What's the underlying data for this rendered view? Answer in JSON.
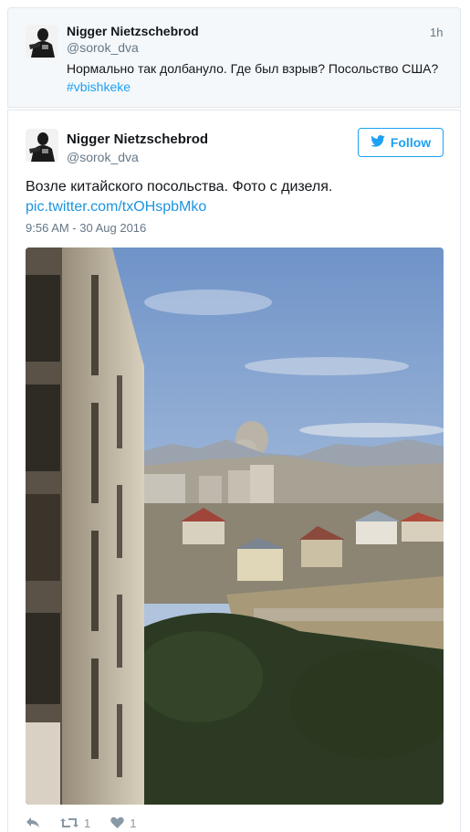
{
  "parent_tweet": {
    "name": "Nigger Nietzschebrod",
    "handle": "@sorok_dva",
    "time": "1h",
    "text": "Нормально так долбануло. Где был взрыв? Посольство США?",
    "hashtag": "#vbishkeke"
  },
  "main_tweet": {
    "name": "Nigger Nietzschebrod",
    "handle": "@sorok_dva",
    "follow_label": "Follow",
    "text": "Возле китайского посольства. Фото с дизеля.",
    "link": "pic.twitter.com/txOHspbMko",
    "timestamp": "9:56 AM - 30 Aug 2016",
    "retweet_count": "1",
    "like_count": "1"
  },
  "icons": {
    "reply": "reply-icon",
    "retweet": "retweet-icon",
    "like": "heart-icon",
    "follow": "twitter-bird-icon"
  },
  "colors": {
    "accent": "#1da1f2",
    "muted": "#657786",
    "action_gray": "#8899a6"
  }
}
